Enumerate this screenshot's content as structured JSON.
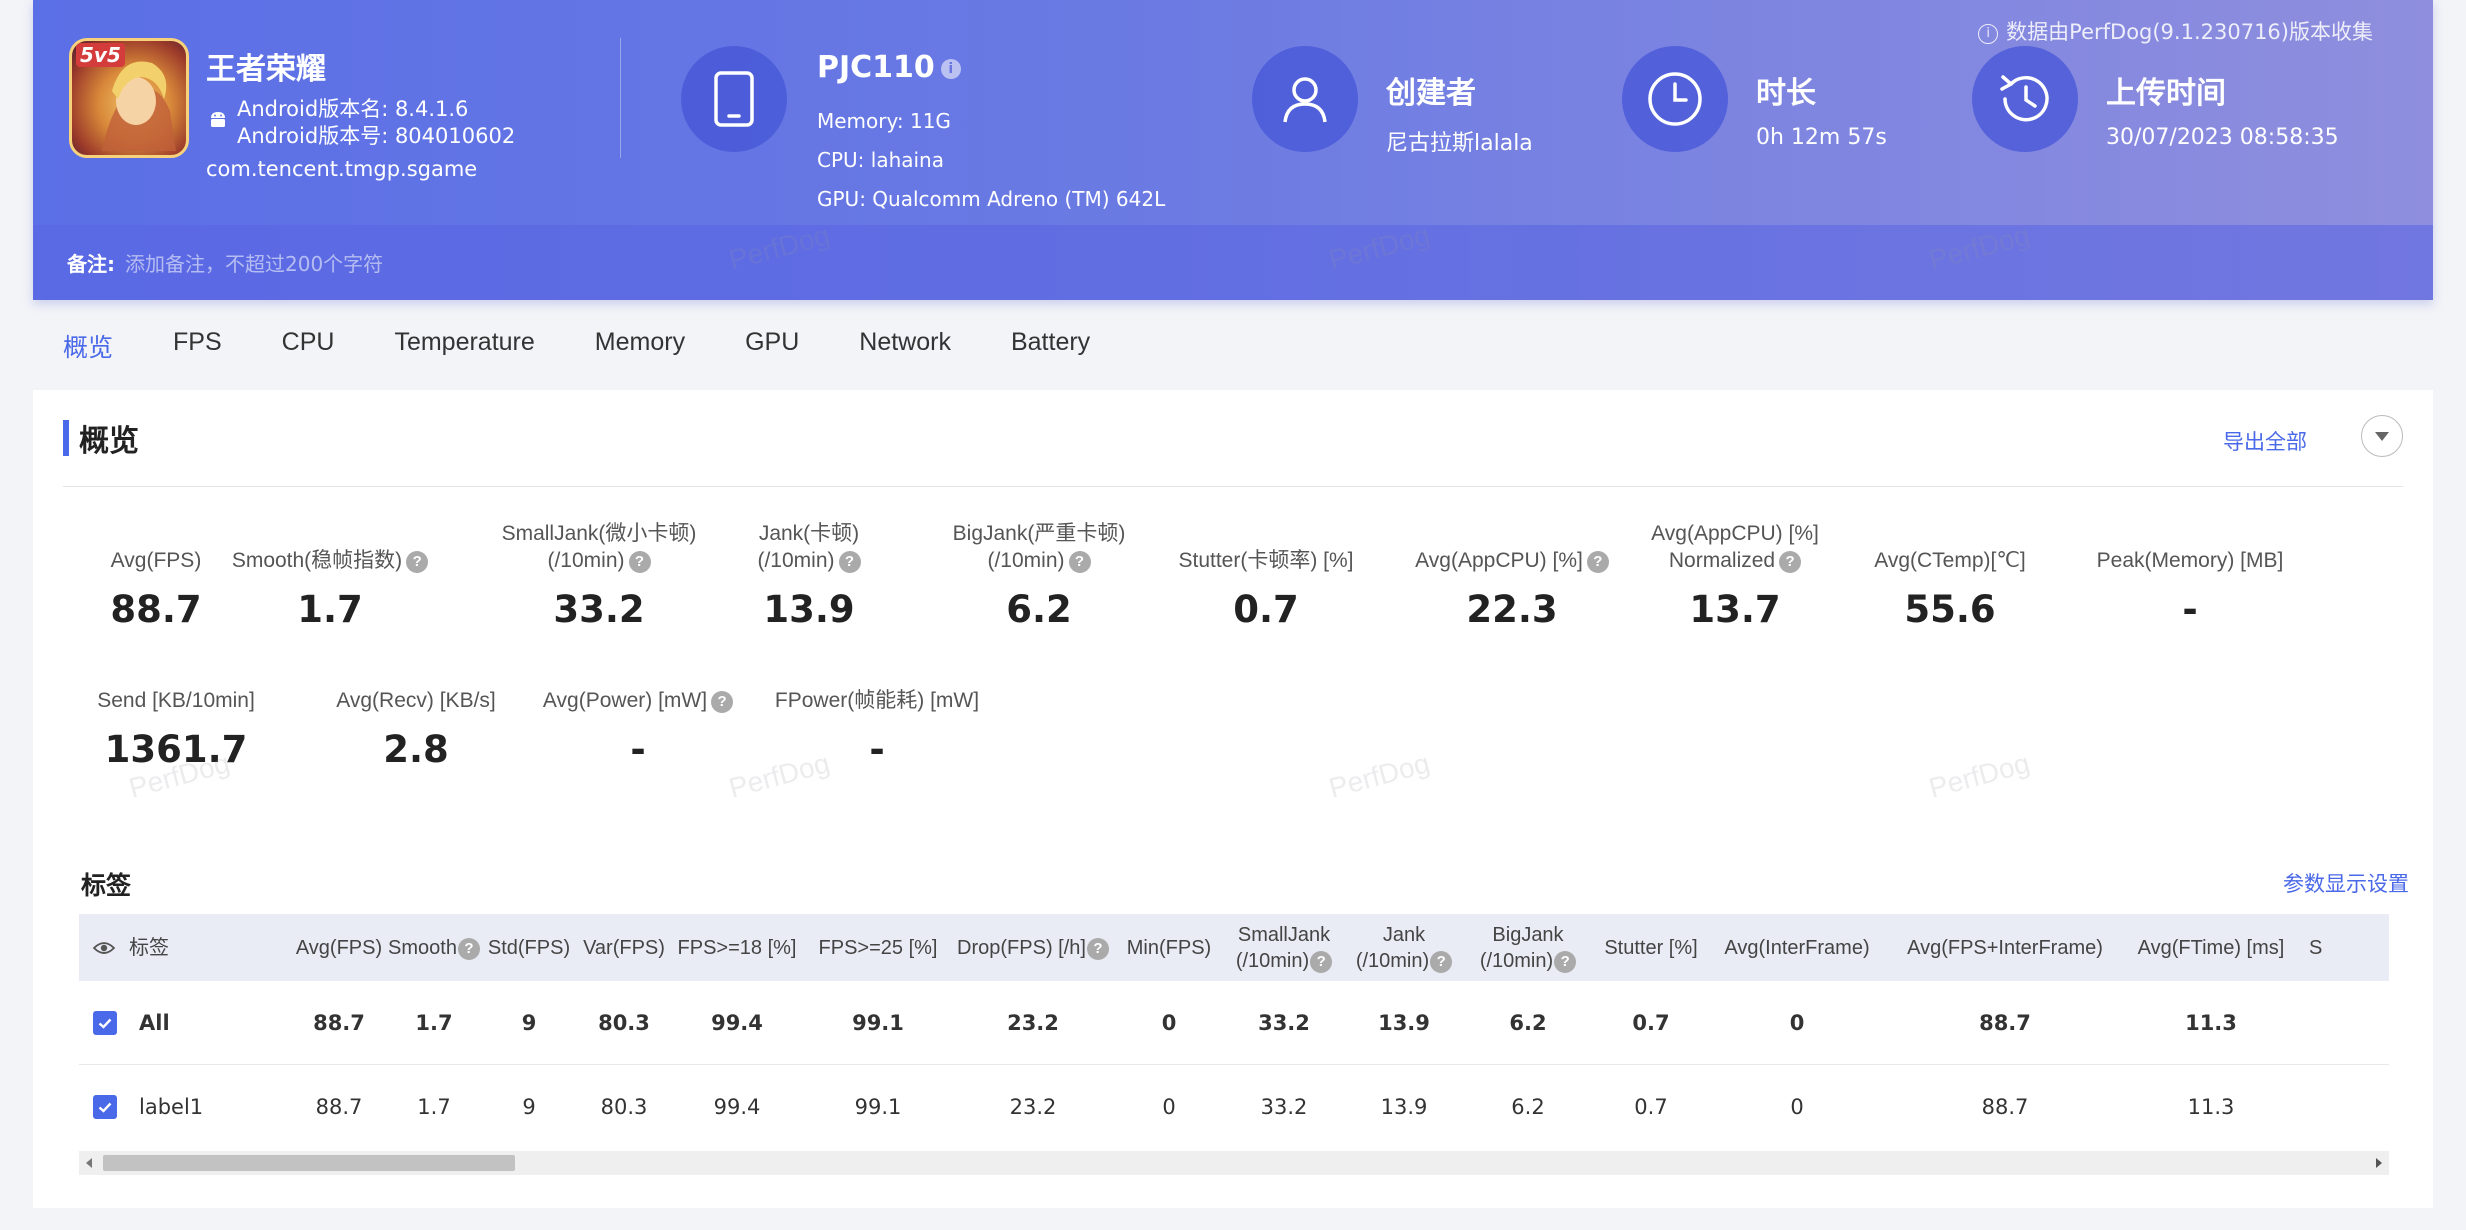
{
  "header": {
    "app": {
      "name": "王者荣耀",
      "icon_badge": "5v5",
      "version_name": "Android版本名: 8.4.1.6",
      "version_code": "Android版本号: 804010602",
      "package": "com.tencent.tmgp.sgame"
    },
    "device": {
      "model": "PJC110",
      "memory": "Memory: 11G",
      "cpu": "CPU: lahaina",
      "gpu": "GPU: Qualcomm Adreno (TM) 642L"
    },
    "creator": {
      "title": "创建者",
      "value": "尼古拉斯lalala"
    },
    "duration": {
      "title": "时长",
      "value": "0h 12m 57s"
    },
    "upload": {
      "title": "上传时间",
      "value": "30/07/2023 08:58:35"
    },
    "note": "数据由PerfDog(9.1.230716)版本收集",
    "remark": {
      "label": "备注:",
      "placeholder": "添加备注，不超过200个字符"
    },
    "watermark": "PerfDog",
    "colors": {
      "gradient_start": "#5b6fe6",
      "gradient_end": "#8f8ede",
      "accent": "#4a69e8"
    }
  },
  "tabs": [
    "概览",
    "FPS",
    "CPU",
    "Temperature",
    "Memory",
    "GPU",
    "Network",
    "Battery"
  ],
  "active_tab": "概览",
  "overview": {
    "title": "概览",
    "export_label": "导出全部",
    "metrics": [
      {
        "label": "Avg(FPS)",
        "value": "88.7"
      },
      {
        "label": "Smooth(稳帧指数)",
        "value": "1.7",
        "help": true
      },
      {
        "label": "SmallJank(微小卡顿)",
        "label2": "(/10min)",
        "value": "33.2",
        "help": true
      },
      {
        "label": "Jank(卡顿)",
        "label2": "(/10min)",
        "value": "13.9",
        "help": true
      },
      {
        "label": "BigJank(严重卡顿)",
        "label2": "(/10min)",
        "value": "6.2",
        "help": true
      },
      {
        "label": "Stutter(卡顿率) [%]",
        "value": "0.7"
      },
      {
        "label": "Avg(AppCPU) [%]",
        "value": "22.3",
        "help": true
      },
      {
        "label": "Avg(AppCPU) [%]",
        "label2": "Normalized",
        "value": "13.7",
        "help": true
      },
      {
        "label": "Avg(CTemp)[℃]",
        "value": "55.6"
      },
      {
        "label": "Peak(Memory) [MB]",
        "value": "-"
      },
      {
        "label": "Send [KB/10min]",
        "value": "1361.7"
      },
      {
        "label": "Avg(Recv) [KB/s]",
        "value": "2.8"
      },
      {
        "label": "Avg(Power) [mW]",
        "value": "-",
        "help": true
      },
      {
        "label": "FPower(帧能耗) [mW]",
        "value": "-"
      }
    ]
  },
  "tags": {
    "title": "标签",
    "settings_label": "参数显示设置",
    "columns": [
      {
        "label": "标签"
      },
      {
        "label": "Avg(FPS)"
      },
      {
        "label": "Smooth",
        "help": true
      },
      {
        "label": "Std(FPS)"
      },
      {
        "label": "Var(FPS)"
      },
      {
        "label": "FPS>=18 [%]"
      },
      {
        "label": "FPS>=25 [%]"
      },
      {
        "label": "Drop(FPS) [/h]",
        "help": true
      },
      {
        "label": "Min(FPS)"
      },
      {
        "label": "SmallJank",
        "label2": "(/10min)",
        "help": true
      },
      {
        "label": "Jank",
        "label2": "(/10min)",
        "help": true
      },
      {
        "label": "BigJank",
        "label2": "(/10min)",
        "help": true
      },
      {
        "label": "Stutter [%]"
      },
      {
        "label": "Avg(InterFrame)"
      },
      {
        "label": "Avg(FPS+InterFrame)"
      },
      {
        "label": "Avg(FTime) [ms]"
      },
      {
        "label": "S"
      }
    ],
    "rows": [
      {
        "name": "All",
        "checked": true,
        "values": [
          "88.7",
          "1.7",
          "9",
          "80.3",
          "99.4",
          "99.1",
          "23.2",
          "0",
          "33.2",
          "13.9",
          "6.2",
          "0.7",
          "0",
          "88.7",
          "11.3"
        ]
      },
      {
        "name": "label1",
        "checked": true,
        "values": [
          "88.7",
          "1.7",
          "9",
          "80.3",
          "99.4",
          "99.1",
          "23.2",
          "0",
          "33.2",
          "13.9",
          "6.2",
          "0.7",
          "0",
          "88.7",
          "11.3"
        ]
      }
    ]
  }
}
